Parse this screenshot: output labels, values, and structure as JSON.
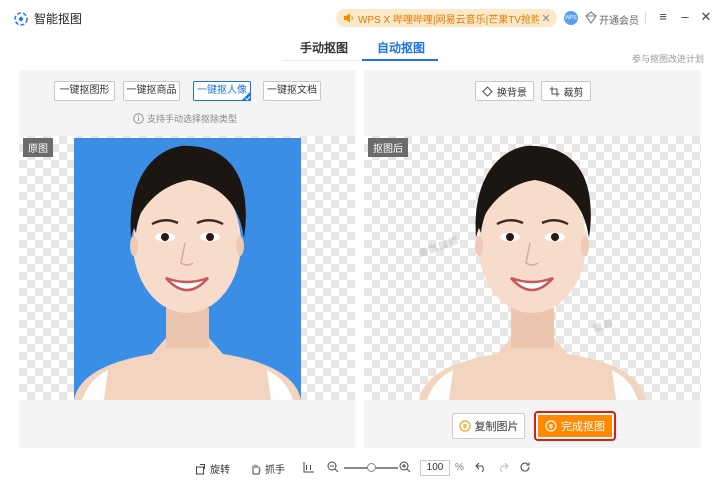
{
  "app": {
    "title": "智能抠图",
    "ad_text": "WPS X 哔哩哔哩|网易云音乐|芒果TV抢购中!",
    "avatar_text": "WPS",
    "vip_label": "开通会员"
  },
  "tabs": [
    {
      "label": "手动抠图",
      "active": false
    },
    {
      "label": "自动抠图",
      "active": true
    }
  ],
  "feedback_link": "参与抠图改进计划",
  "left_panel": {
    "mode_buttons": [
      {
        "label": "一键抠图形",
        "selected": false
      },
      {
        "label": "一键抠商品",
        "selected": false
      },
      {
        "label": "一键抠人像",
        "selected": true
      },
      {
        "label": "一键抠文档",
        "selected": false
      }
    ],
    "hint": "支持手动选择抠除类型",
    "tag": "原图"
  },
  "right_panel": {
    "tools": [
      {
        "label": "换背景",
        "icon": "diamond-icon"
      },
      {
        "label": "裁剪",
        "icon": "crop-icon"
      }
    ],
    "tag": "抠图后",
    "copy_button": "复制图片",
    "done_button": "完成抠图"
  },
  "bottombar": {
    "rotate": "旋转",
    "grab": "抓手",
    "zoom_value": "100",
    "zoom_unit": "%"
  },
  "colors": {
    "accent": "#1a73e8",
    "orange": "#ff8a00",
    "photo_bg": "#3a8ee6",
    "highlight": "#e01a1a"
  }
}
